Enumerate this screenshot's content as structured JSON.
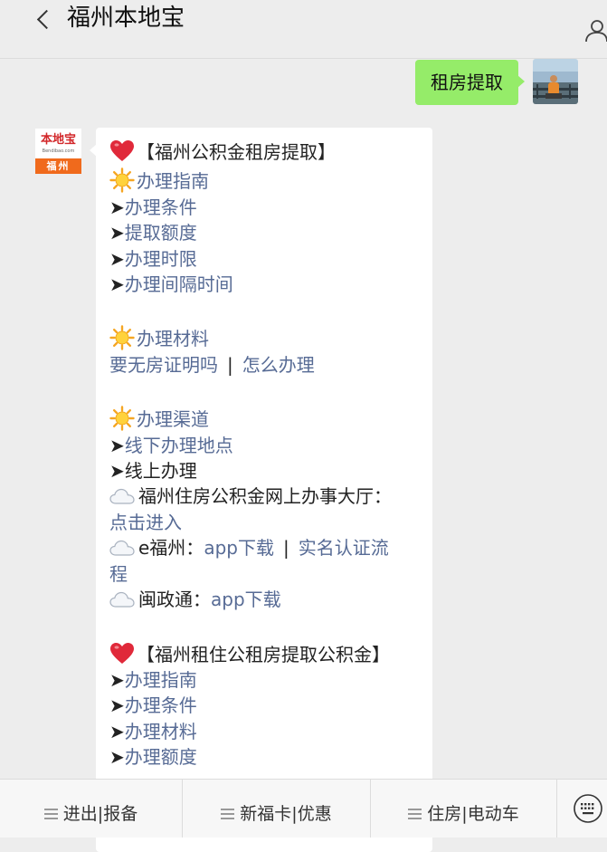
{
  "header": {
    "title": "福州本地宝"
  },
  "outgoing_message": {
    "text": "租房提取"
  },
  "bot": {
    "avatar": {
      "brand": "本地宝",
      "url": "Bendibao.com",
      "city": "福州"
    }
  },
  "reply": {
    "section1_title": "【福州公积金租房提取】",
    "guide": {
      "heading": "办理指南",
      "items": [
        "办理条件",
        "提取额度",
        "办理时限",
        "办理间隔时间"
      ]
    },
    "materials": {
      "heading": "办理材料",
      "link1": "要无房证明吗",
      "separator": "|",
      "link2": "怎么办理"
    },
    "channels": {
      "heading": "办理渠道",
      "offline": "线下办理地点",
      "online": "线上办理",
      "hall_label": "福州住房公积金网上办事大厅：",
      "hall_link": "点击进入",
      "efz_label": "e福州：",
      "efz_link1": "app下载",
      "efz_sep": "|",
      "efz_link2_a": "实名认证流",
      "efz_link2_b": "程",
      "mzt_label": "闽政通：",
      "mzt_link": "app下载"
    },
    "section2_title": "【福州租住公租房提取公积金】",
    "section2_items": [
      "办理指南",
      "办理条件",
      "办理材料",
      "办理额度"
    ]
  },
  "bottom_menu": {
    "items": [
      "进出|报备",
      "新福卡|优惠",
      "住房|电动车"
    ]
  },
  "colors": {
    "outgoing_bubble": "#95ec69",
    "link": "#576b95",
    "background": "#ededed",
    "brand_orange": "#f06a1c",
    "brand_red": "#d2272a"
  },
  "icons": {
    "back": "chevron-left-icon",
    "profile": "person-icon",
    "heart": "heart-icon",
    "sun": "sun-icon",
    "cloud": "cloud-icon",
    "keyboard": "keyboard-icon"
  }
}
